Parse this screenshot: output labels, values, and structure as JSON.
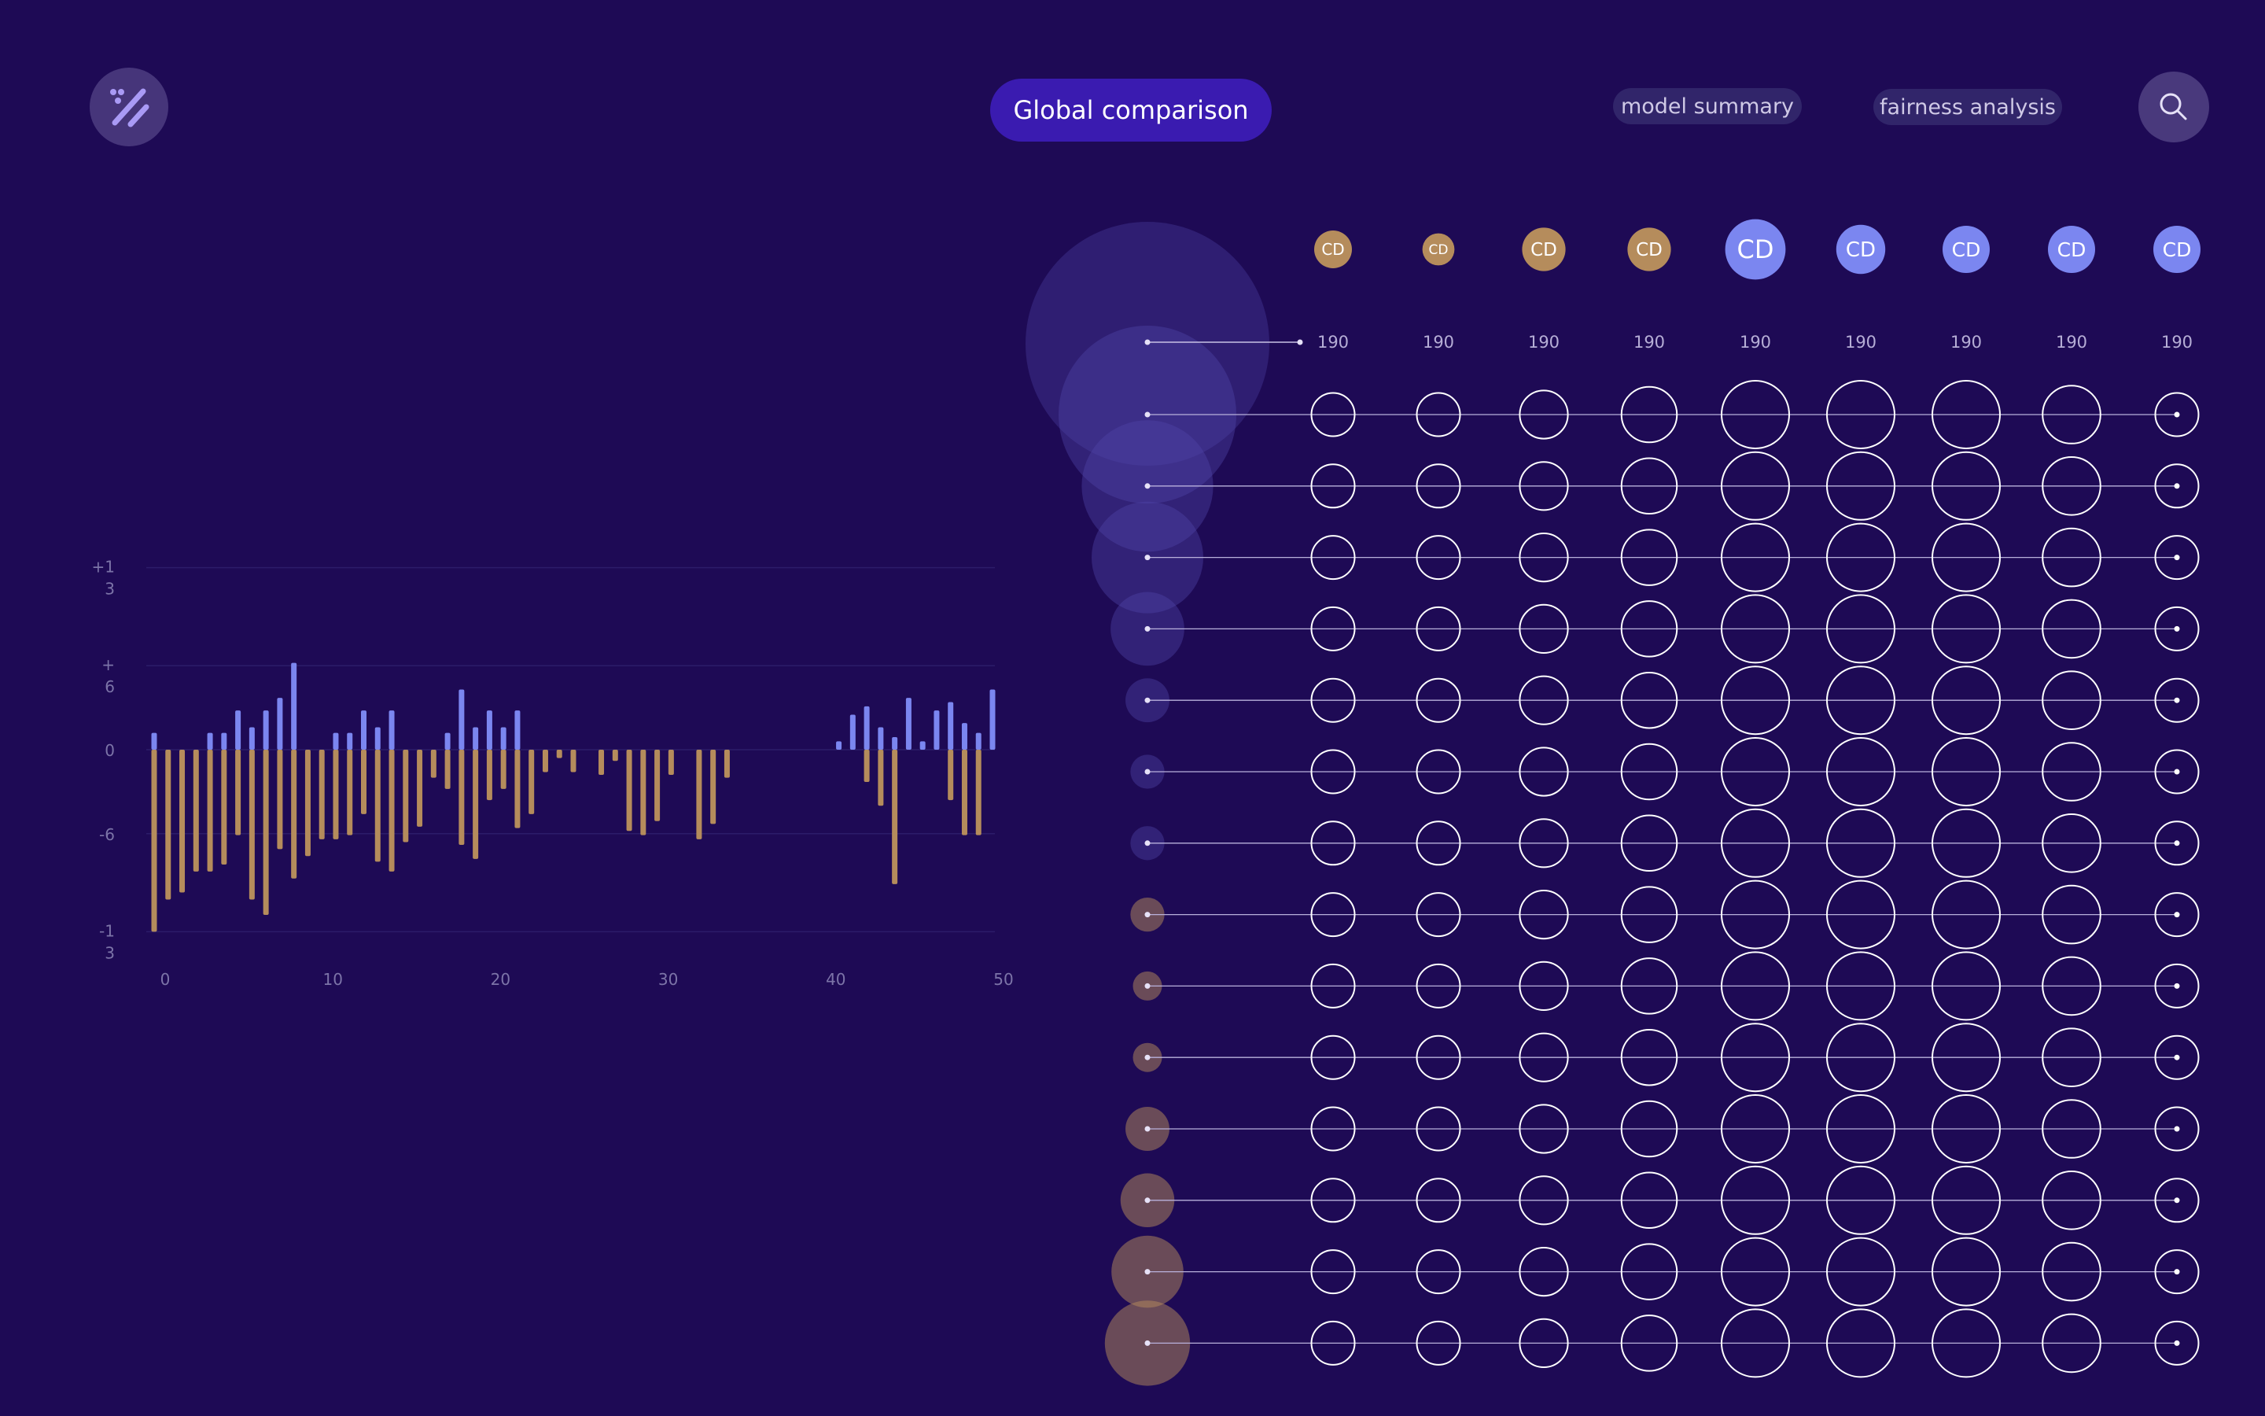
{
  "header": {
    "logo_icon": "percent-icon",
    "title_button": "Global comparison",
    "tabs": [
      {
        "label": "model summary"
      },
      {
        "label": "fairness analysis"
      }
    ],
    "search_icon": "search-icon"
  },
  "colors": {
    "background": "#1e0a55",
    "positive": "#7b86f0",
    "negative": "#b58c5c",
    "accent": "#3a1bb0"
  },
  "chart_data": {
    "type": "bar",
    "y_ticks": [
      {
        "value": 13,
        "label": "+1\n3"
      },
      {
        "value": 6,
        "label": "+\n6"
      },
      {
        "value": 0,
        "label": "0"
      },
      {
        "value": -6,
        "label": "-6"
      },
      {
        "value": -13,
        "label": "-1\n3"
      }
    ],
    "x_ticks": [
      0,
      10,
      20,
      30,
      40,
      50
    ],
    "xlim": [
      0,
      50
    ],
    "ylim": [
      -13,
      13
    ],
    "grid": true,
    "series": [
      {
        "name": "",
        "color": "#7b86f0",
        "values": [
          1.2,
          0,
          0,
          0,
          1.2,
          1.2,
          2.8,
          1.6,
          2.8,
          3.7,
          6.2,
          0,
          0,
          1.2,
          1.2,
          2.8,
          1.6,
          2.8,
          0,
          0,
          0,
          1.2,
          4.3,
          1.6,
          2.8,
          1.6,
          2.8,
          0,
          0,
          0,
          0,
          0,
          0,
          0,
          0,
          0,
          0,
          0,
          0,
          0,
          0,
          0,
          0,
          0,
          0,
          0,
          0,
          0,
          0,
          0.6,
          2.5,
          3.1,
          1.6,
          0.9,
          3.7,
          0.6,
          2.8,
          3.4,
          1.9,
          1.2,
          4.3
        ]
      },
      {
        "name": "",
        "color": "#b58c5c",
        "values": [
          -13,
          -10.7,
          -10.2,
          -8.7,
          -8.7,
          -8.2,
          -6.1,
          -10.7,
          -11.8,
          -7.1,
          -9.2,
          -7.6,
          -6.4,
          -6.4,
          -6.1,
          -4.6,
          -8,
          -8.7,
          -6.6,
          -5.5,
          -2,
          -2.8,
          -6.8,
          -7.8,
          -3.6,
          -2.8,
          -5.6,
          -4.6,
          -1.6,
          -0.6,
          -1.6,
          0,
          -1.8,
          -0.8,
          -5.8,
          -6.1,
          -5.1,
          -1.8,
          0,
          -6.4,
          -5.3,
          -2,
          0,
          0,
          0,
          0,
          0,
          0,
          0,
          0,
          0,
          -2.3,
          -4,
          -9.6,
          0,
          0,
          0,
          -3.6,
          -6.1,
          -6.1,
          0
        ]
      }
    ]
  },
  "matrix": {
    "columns": [
      {
        "badge": "CD",
        "label": "190",
        "color": "#b58c5c",
        "size": 1
      },
      {
        "badge": "CD",
        "label": "190",
        "color": "#b58c5c",
        "size": 0.85
      },
      {
        "badge": "CD",
        "label": "190",
        "color": "#b58c5c",
        "size": 1.15
      },
      {
        "badge": "CD",
        "label": "190",
        "color": "#b58c5c",
        "size": 1.15
      },
      {
        "badge": "CD",
        "label": "190",
        "color": "#7b86f0",
        "size": 1.6
      },
      {
        "badge": "CD",
        "label": "190",
        "color": "#7b86f0",
        "size": 1.3
      },
      {
        "badge": "CD",
        "label": "190",
        "color": "#7b86f0",
        "size": 1.25
      },
      {
        "badge": "CD",
        "label": "190",
        "color": "#7b86f0",
        "size": 1.25
      },
      {
        "badge": "CD",
        "label": "190",
        "color": "#7b86f0",
        "size": 1.25
      }
    ],
    "row_weights": [
      {
        "value": 1.0,
        "tone": "positive"
      },
      {
        "value": 0.72,
        "tone": "positive"
      },
      {
        "value": 0.6,
        "tone": "positive"
      },
      {
        "value": 0.37,
        "tone": "positive"
      },
      {
        "value": 0.19,
        "tone": "positive"
      },
      {
        "value": 0.13,
        "tone": "positive"
      },
      {
        "value": 0.13,
        "tone": "positive"
      },
      {
        "value": 0.13,
        "tone": "negative"
      },
      {
        "value": 0.1,
        "tone": "negative"
      },
      {
        "value": 0.1,
        "tone": "negative"
      },
      {
        "value": 0.19,
        "tone": "negative"
      },
      {
        "value": 0.25,
        "tone": "negative"
      },
      {
        "value": 0.36,
        "tone": "negative"
      },
      {
        "value": 0.44,
        "tone": "negative"
      }
    ],
    "cell_scale": [
      0.5,
      0.5,
      0.6,
      0.75,
      1.0,
      1.0,
      1.0,
      0.8,
      0.5
    ]
  }
}
